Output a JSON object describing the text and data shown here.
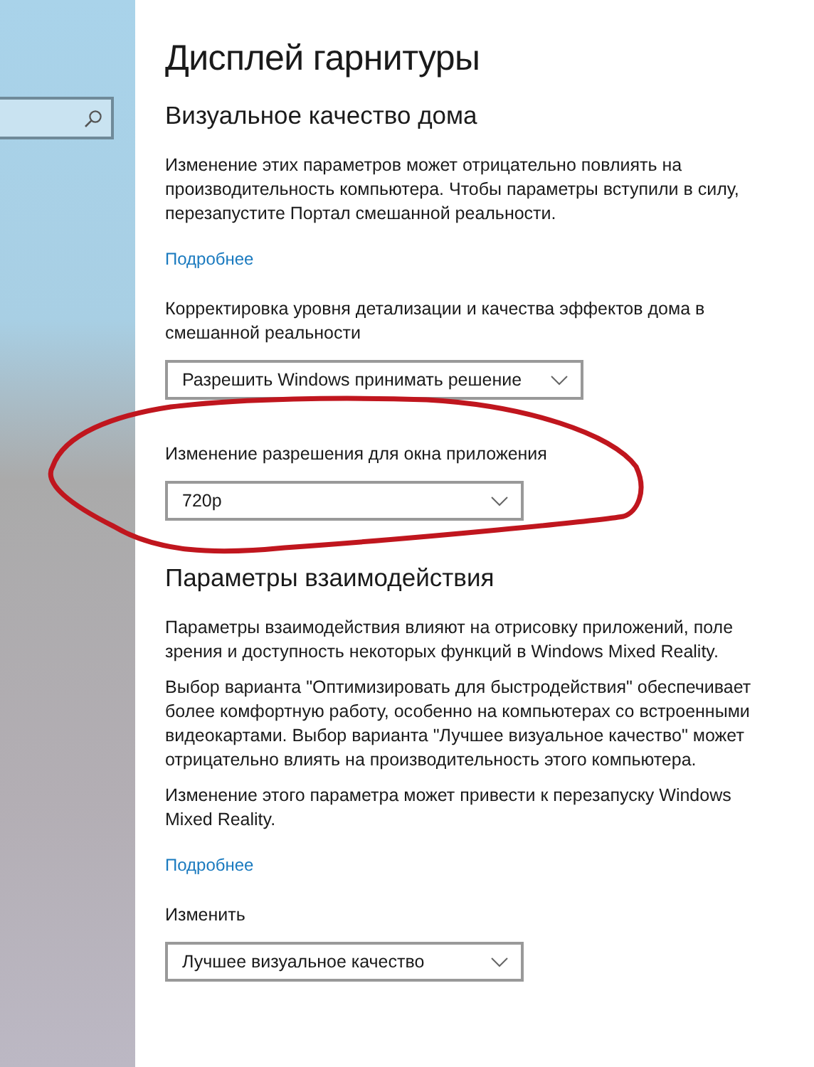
{
  "page": {
    "title": "Дисплей гарнитуры"
  },
  "sections": [
    {
      "heading": "Визуальное качество дома",
      "items": [
        {
          "kind": "text",
          "text": "Изменение этих параметров может отрицательно повлиять на производительность компьютера. Чтобы параметры вступили в силу, перезапустите Портал смешанной реальности."
        },
        {
          "kind": "link",
          "text": "Подробнее"
        },
        {
          "kind": "label",
          "text": "Корректировка уровня детализации и качества эффектов дома в смешанной реальности"
        },
        {
          "kind": "dropdown",
          "value": "Разрешить Windows принимать решение"
        },
        {
          "kind": "label",
          "text": "Изменение разрешения для окна приложения"
        },
        {
          "kind": "dropdown",
          "value": "720p"
        }
      ]
    },
    {
      "heading": "Параметры взаимодействия",
      "items": [
        {
          "kind": "text",
          "text": "Параметры взаимодействия влияют на отрисовку приложений, поле зрения и доступность некоторых функций в Windows Mixed Reality."
        },
        {
          "kind": "text",
          "text": "Выбор варианта \"Оптимизировать для быстродействия\" обеспечивает более комфортную работу, особенно на компьютерах со встроенными видеокартами. Выбор варианта \"Лучшее визуальное качество\" может отрицательно влиять на производительность этого компьютера."
        },
        {
          "kind": "text",
          "text": "Изменение этого параметра может привести к перезапуску Windows Mixed Reality."
        },
        {
          "kind": "link",
          "text": "Подробнее"
        },
        {
          "kind": "label",
          "text": "Изменить"
        },
        {
          "kind": "dropdown",
          "value": "Лучшее визуальное качество"
        }
      ]
    }
  ],
  "annotation": {
    "color": "#c0161e"
  }
}
